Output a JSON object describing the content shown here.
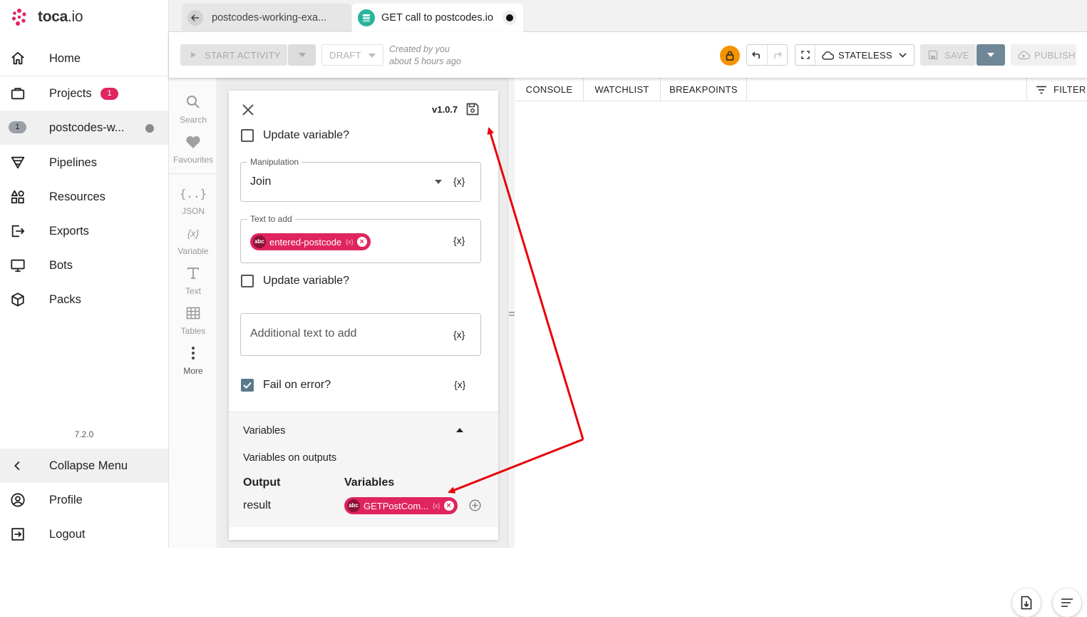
{
  "app": {
    "brand_bold": "toca",
    "brand_rest": ".io",
    "version": "7.2.0"
  },
  "sidebar": {
    "items": [
      {
        "label": "Home",
        "icon": "home-icon"
      },
      {
        "label": "Projects",
        "icon": "briefcase-icon",
        "badge": "1"
      },
      {
        "label": "postcodes-w...",
        "icon": "project-index-badge",
        "index": "1"
      },
      {
        "label": "Pipelines",
        "icon": "pipeline-icon"
      },
      {
        "label": "Resources",
        "icon": "resources-icon"
      },
      {
        "label": "Exports",
        "icon": "export-icon"
      },
      {
        "label": "Bots",
        "icon": "monitor-icon"
      },
      {
        "label": "Packs",
        "icon": "package-icon"
      }
    ],
    "collapse_label": "Collapse Menu",
    "profile_label": "Profile",
    "logout_label": "Logout"
  },
  "tabs": [
    {
      "label": "postcodes-working-exa...",
      "icon": "back-arrow-icon"
    },
    {
      "label": "GET call to postcodes.io",
      "icon": "component-icon",
      "unsaved": true
    }
  ],
  "toolbar": {
    "start_activity": "START ACTIVITY",
    "draft": "DRAFT",
    "created_line1": "Created by you",
    "created_line2": "about 5 hours ago",
    "mode": "STATELESS",
    "save": "SAVE",
    "publish": "PUBLISH"
  },
  "palette": [
    {
      "label": "Search",
      "icon": "search-icon"
    },
    {
      "label": "Favourites",
      "icon": "heart-icon"
    },
    {
      "label": "JSON",
      "icon": "json-braces-icon",
      "glyph": "{..}"
    },
    {
      "label": "Variable",
      "icon": "variable-icon",
      "glyph": "{x}"
    },
    {
      "label": "Text",
      "icon": "text-icon"
    },
    {
      "label": "Tables",
      "icon": "table-icon"
    },
    {
      "label": "More",
      "icon": "more-vertical-icon"
    }
  ],
  "properties": {
    "version": "v1.0.7",
    "update_variable_1": "Update variable?",
    "manipulation": {
      "legend": "Manipulation",
      "value": "Join"
    },
    "text_to_add": {
      "legend": "Text to add",
      "chip": "entered-postcode"
    },
    "update_variable_2": "Update variable?",
    "additional_text_placeholder": "Additional text to add",
    "fail_on_error": "Fail on error?",
    "fx": "{x}",
    "chip_abc": "abc",
    "chip_vx": "{x}",
    "variables": {
      "title": "Variables",
      "subtitle": "Variables on outputs",
      "col_output": "Output",
      "col_variables": "Variables",
      "row_output": "result",
      "row_chip": "GETPostCom..."
    }
  },
  "console": {
    "tabs": [
      "CONSOLE",
      "WATCHLIST",
      "BREAKPOINTS"
    ],
    "filter": "FILTER"
  },
  "colors": {
    "accent": "#e0245e",
    "lock": "#f59200",
    "annotation": "#e8000b",
    "save_dropdown": "#6f8796"
  }
}
